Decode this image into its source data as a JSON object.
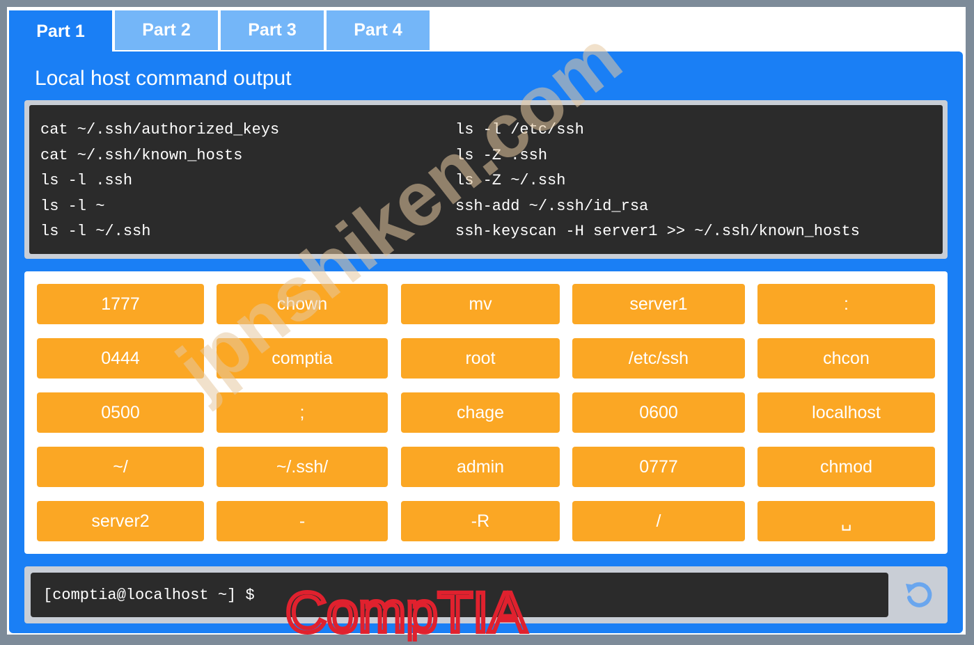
{
  "tabs": [
    {
      "label": "Part 1",
      "active": true
    },
    {
      "label": "Part 2",
      "active": false
    },
    {
      "label": "Part 3",
      "active": false
    },
    {
      "label": "Part 4",
      "active": false
    }
  ],
  "panel": {
    "title": "Local host command output"
  },
  "output": {
    "left": [
      "cat ~/.ssh/authorized_keys",
      "cat ~/.ssh/known_hosts",
      "ls -l .ssh",
      "ls -l ~",
      "ls -l ~/.ssh"
    ],
    "right": [
      "ls -l /etc/ssh",
      "ls -Z .ssh",
      "ls -Z ~/.ssh",
      "ssh-add ~/.ssh/id_rsa",
      "ssh-keyscan -H server1 >> ~/.ssh/known_hosts"
    ]
  },
  "tiles": [
    [
      "1777",
      "chown",
      "mv",
      "server1",
      ":"
    ],
    [
      "0444",
      "comptia",
      "root",
      "/etc/ssh",
      "chcon"
    ],
    [
      "0500",
      ";",
      "chage",
      "0600",
      "localhost"
    ],
    [
      "~/",
      "~/.ssh/",
      "admin",
      "0777",
      "chmod"
    ],
    [
      "server2",
      "-",
      "-R",
      "/",
      "␣"
    ]
  ],
  "cli": {
    "prompt": "[comptia@localhost ~] $",
    "icon": "reset-icon"
  },
  "watermark": "jpnshiken.com",
  "logo": "CompTIA",
  "colors": {
    "accent": "#1a7ff5",
    "tab_inactive": "#74b6f8",
    "tile": "#fba724",
    "terminal": "#2b2b2b",
    "logo": "#e0212e"
  }
}
